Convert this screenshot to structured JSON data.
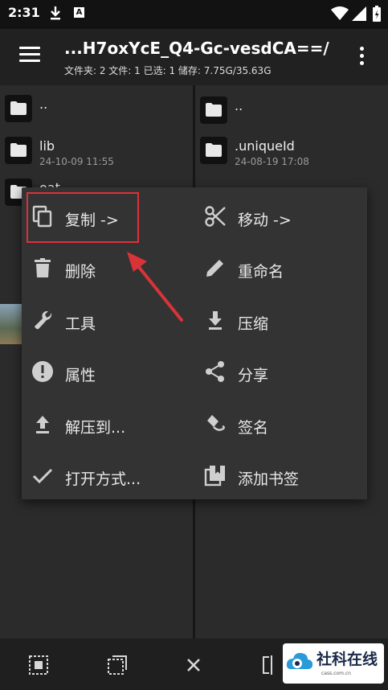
{
  "status": {
    "time": "2:31",
    "badge": "A"
  },
  "appbar": {
    "title": "...H7oxYcE_Q4-Gc-vesdCA==/",
    "subtitle": "文件夹: 2  文件: 1  已选: 1  储存: 7.75G/35.63G"
  },
  "left_pane": {
    "rows": [
      {
        "name": "..",
        "date": ""
      },
      {
        "name": "lib",
        "date": "24-10-09 11:55"
      },
      {
        "name": "oat",
        "date": ""
      }
    ]
  },
  "right_pane": {
    "rows": [
      {
        "name": "..",
        "date": ""
      },
      {
        "name": ".uniqueId",
        "date": "24-08-19 17:08"
      }
    ]
  },
  "menu": {
    "left": [
      {
        "label": "复制 ->",
        "icon": "copy-icon"
      },
      {
        "label": "删除",
        "icon": "delete-icon"
      },
      {
        "label": "工具",
        "icon": "wrench-icon"
      },
      {
        "label": "属性",
        "icon": "info-icon"
      },
      {
        "label": "解压到...",
        "icon": "upload-icon"
      },
      {
        "label": "打开方式...",
        "icon": "check-icon"
      }
    ],
    "right": [
      {
        "label": "移动 ->",
        "icon": "scissors-icon"
      },
      {
        "label": "重命名",
        "icon": "pencil-icon"
      },
      {
        "label": "压缩",
        "icon": "download-icon"
      },
      {
        "label": "分享",
        "icon": "share-icon"
      },
      {
        "label": "签名",
        "icon": "signature-icon"
      },
      {
        "label": "添加书签",
        "icon": "bookmark-icon"
      }
    ]
  },
  "watermark": {
    "text": "社科在线",
    "url": "cass.com.cn"
  },
  "colors": {
    "highlight": "#d9333a",
    "menu_bg": "#333333",
    "pane_bg": "#2b2b2b"
  }
}
